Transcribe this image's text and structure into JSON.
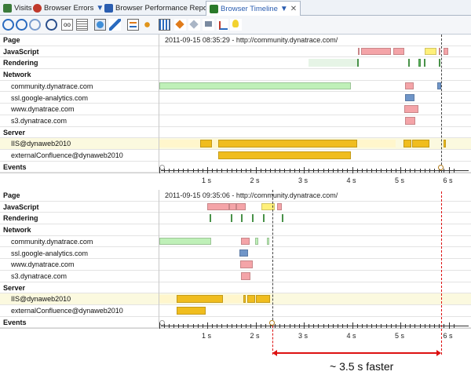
{
  "tabs": [
    {
      "label": "Visits",
      "icon": "visits-icon",
      "color": "#3a7a3a"
    },
    {
      "label": "Browser Errors",
      "icon": "errors-icon",
      "color": "#c0392b"
    },
    {
      "label": "Browser Performance Report",
      "icon": "report-icon",
      "color": "#2a5db0"
    },
    {
      "label": "Browser Timeline",
      "icon": "timeline-icon",
      "color": "#2a7a2a"
    }
  ],
  "panels": [
    {
      "page_text": "2011-09-15 08:35:29 - http://community.dynatrace.com/",
      "rows": [
        {
          "label": "Page",
          "bold": true
        },
        {
          "label": "JavaScript",
          "bold": true
        },
        {
          "label": "Rendering",
          "bold": true
        },
        {
          "label": "Network",
          "bold": true
        },
        {
          "label": "community.dynatrace.com",
          "bold": false
        },
        {
          "label": "ssl.google-analytics.com",
          "bold": false
        },
        {
          "label": "www.dynatrace.com",
          "bold": false
        },
        {
          "label": "s3.dynatrace.com",
          "bold": false
        },
        {
          "label": "Server",
          "bold": true
        },
        {
          "label": "IIS@dynaweb2010",
          "bold": false
        },
        {
          "label": "externalConfluence@dynaweb2010",
          "bold": false
        },
        {
          "label": "Events",
          "bold": true
        }
      ],
      "ticks": [
        "1 s",
        "2 s",
        "3 s",
        "4 s",
        "5 s",
        "6 s"
      ]
    },
    {
      "page_text": "2011-09-15 09:35:06 - http://community.dynatrace.com/",
      "rows": [
        {
          "label": "Page",
          "bold": true
        },
        {
          "label": "JavaScript",
          "bold": true
        },
        {
          "label": "Rendering",
          "bold": true
        },
        {
          "label": "Network",
          "bold": true
        },
        {
          "label": "community.dynatrace.com",
          "bold": false
        },
        {
          "label": "ssl.google-analytics.com",
          "bold": false
        },
        {
          "label": "www.dynatrace.com",
          "bold": false
        },
        {
          "label": "s3.dynatrace.com",
          "bold": false
        },
        {
          "label": "Server",
          "bold": true
        },
        {
          "label": "IIS@dynaweb2010",
          "bold": false
        },
        {
          "label": "externalConfluence@dynaweb2010",
          "bold": false
        },
        {
          "label": "Events",
          "bold": true
        }
      ],
      "ticks": [
        "1 s",
        "2 s",
        "3 s",
        "4 s",
        "5 s",
        "6 s"
      ]
    }
  ],
  "caption": "~ 3.5 s faster",
  "colors": {
    "js": "#f4a4a8",
    "rendering": "#59b35a",
    "network": "#bff0b8",
    "server": "#f0bd1e",
    "highlight": "#fff07a",
    "ga": "#6f95c8",
    "accent": "#d11"
  }
}
